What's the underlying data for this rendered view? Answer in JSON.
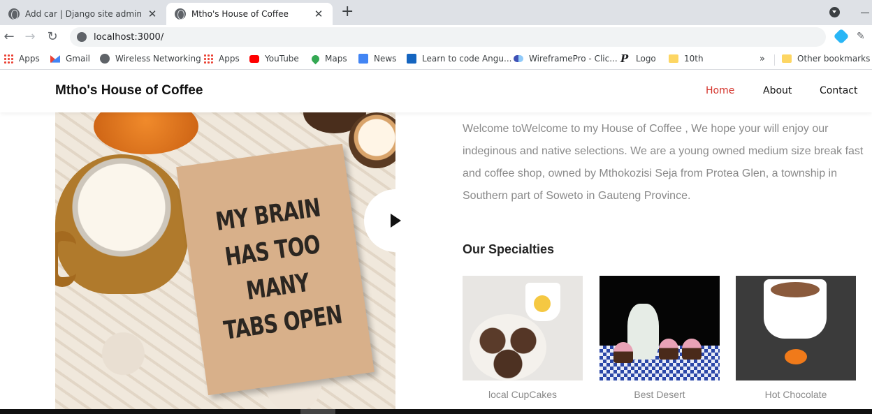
{
  "browser": {
    "tabs": [
      {
        "title": "Add car | Django site admin",
        "active": false
      },
      {
        "title": "Mtho's House of Coffee",
        "active": true
      }
    ],
    "url": "localhost:3000/",
    "bookmarks": [
      {
        "label": "Apps",
        "icon": "apps-grid-icon"
      },
      {
        "label": "Gmail",
        "icon": "gmail-icon"
      },
      {
        "label": "Wireless Networking",
        "icon": "globe-icon"
      },
      {
        "label": "Apps",
        "icon": "apps-grid-icon"
      },
      {
        "label": "YouTube",
        "icon": "youtube-icon"
      },
      {
        "label": "Maps",
        "icon": "maps-icon"
      },
      {
        "label": "News",
        "icon": "news-icon"
      },
      {
        "label": "Learn to code Angu...",
        "icon": "learn-icon"
      },
      {
        "label": "WireframePro - Clic...",
        "icon": "wireframepro-icon"
      },
      {
        "label": "Logo",
        "icon": "p-logo-icon"
      },
      {
        "label": "10th",
        "icon": "folder-icon"
      }
    ],
    "other_bookmarks": "Other bookmarks"
  },
  "site": {
    "brand": "Mtho's House of Coffee",
    "nav": {
      "home": "Home",
      "about": "About",
      "contact": "Contact"
    },
    "accent_color": "#d4342c",
    "hero_notebook_text": [
      "MY BRAIN",
      "HAS TOO",
      "MANY",
      "TABS OPEN"
    ],
    "intro": "Welcome toWelcome to my House of Coffee , We hope your will enjoy our indeginous and native selections. We are a young owned medium size break fast and coffee shop, owned by Mthokozisi Seja from Protea Glen, a township in Southern part of Soweto in Gauteng Province.",
    "specialties_title": "Our Specialties",
    "specialties": [
      {
        "caption": "local CupCakes"
      },
      {
        "caption": "Best Desert"
      },
      {
        "caption": "Hot Chocolate"
      }
    ]
  }
}
